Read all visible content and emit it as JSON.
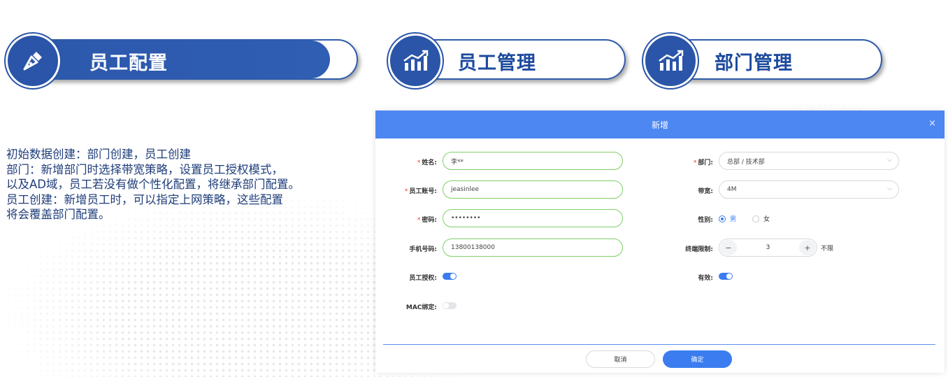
{
  "headers": [
    {
      "label": "员工配置",
      "icon": "pen-nib-icon",
      "active": true
    },
    {
      "label": "员工管理",
      "icon": "chart-trend-icon",
      "active": false
    },
    {
      "label": "部门管理",
      "icon": "chart-trend-icon",
      "active": false
    }
  ],
  "description": [
    "初始数据创建：部门创建，员工创建",
    "部门：新增部门时选择带宽策略，设置员工授权模式，",
    "以及AD域，员工若没有做个性化配置，将继承部门配置。",
    "员工创建：新增员工时，可以指定上网策略，这些配置",
    "将会覆盖部门配置。"
  ],
  "dialog": {
    "title": "新增",
    "close": "×",
    "left": {
      "name_label": "姓名:",
      "name_value": "李**",
      "account_label": "员工账号:",
      "account_value": "jeasinlee",
      "password_label": "密码:",
      "password_value": "••••••••",
      "phone_label": "手机号码:",
      "phone_value": "13800138000",
      "auth_label": "员工授权:",
      "auth_on": true,
      "mac_label": "MAC绑定:",
      "mac_on": false
    },
    "right": {
      "dept_label": "部门:",
      "dept_value": "总部 / 技术部",
      "bandwidth_label": "带宽:",
      "bandwidth_value": "4M",
      "gender_label": "性别:",
      "gender_male": "男",
      "gender_female": "女",
      "gender_selected": "男",
      "terminal_label": "终端限制:",
      "terminal_minus": "−",
      "terminal_value": "3",
      "terminal_plus": "+",
      "terminal_unlimited": "不限",
      "valid_label": "有效:",
      "valid_on": true
    },
    "cancel": "取消",
    "ok": "确定"
  },
  "colors": {
    "brand": "#2a55a8",
    "accent": "#4d87f2",
    "input_border": "#7fcf6a"
  }
}
